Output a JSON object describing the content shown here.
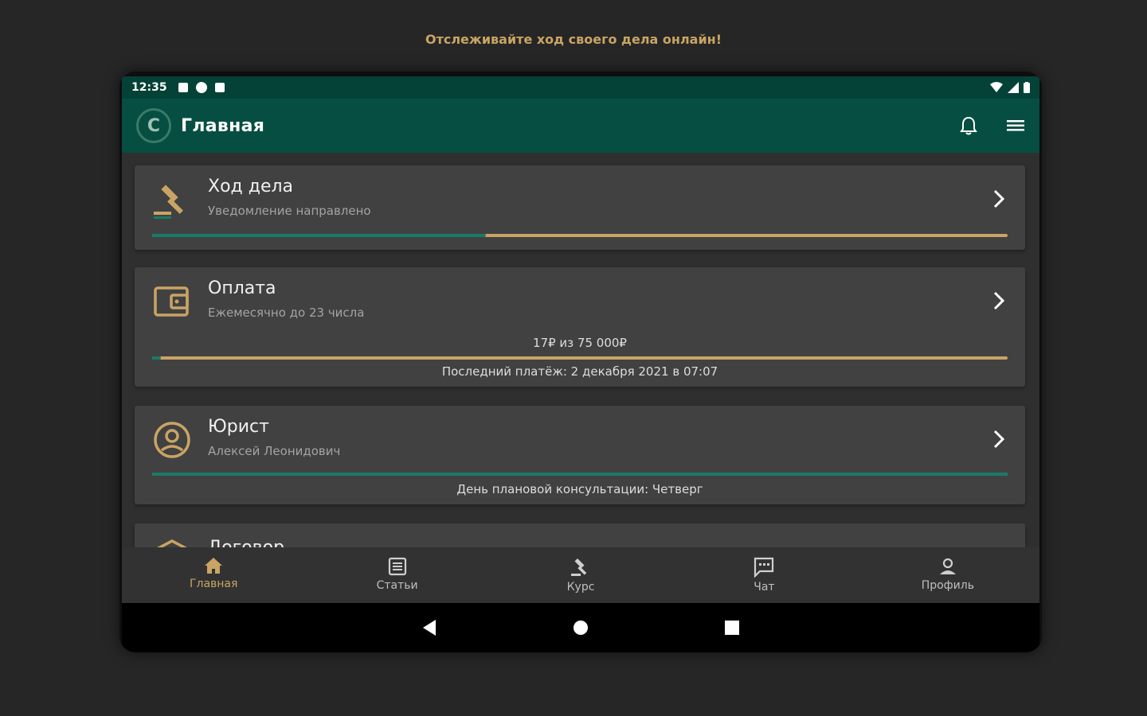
{
  "promo_text": "Отслеживайте ход своего дела онлайн!",
  "status": {
    "time": "12:35"
  },
  "appbar": {
    "title": "Главная",
    "logo_letter": "C"
  },
  "colors": {
    "accent_gold": "#c9a464",
    "accent_teal": "#1a7a68",
    "appbar_bg": "#064e41",
    "statusbar_bg": "#044237"
  },
  "cards": {
    "case": {
      "title": "Ход дела",
      "subtitle": "Уведомление направлено",
      "icon": "gavel-icon",
      "progress": 0.39
    },
    "payment": {
      "title": "Оплата",
      "subtitle": "Ежемесячно до 23 числа",
      "icon": "wallet-icon",
      "amount_text": "17₽ из 75 000₽",
      "progress": 0.01,
      "last_payment": "Последний платёж: 2 декабря 2021 в 07:07"
    },
    "lawyer": {
      "title": "Юрист",
      "subtitle": "Алексей Леонидович",
      "icon": "user-circle-icon",
      "progress": 1.0,
      "consultation": "День плановой консультации: Четверг"
    },
    "contract": {
      "title": "Договор",
      "icon": "document-icon"
    }
  },
  "bottom_nav": {
    "items": [
      {
        "label": "Главная",
        "icon": "home-icon",
        "active": true
      },
      {
        "label": "Статьи",
        "icon": "article-icon",
        "active": false
      },
      {
        "label": "Курс",
        "icon": "gavel-icon",
        "active": false
      },
      {
        "label": "Чат",
        "icon": "chat-icon",
        "active": false
      },
      {
        "label": "Профиль",
        "icon": "profile-icon",
        "active": false
      }
    ]
  }
}
